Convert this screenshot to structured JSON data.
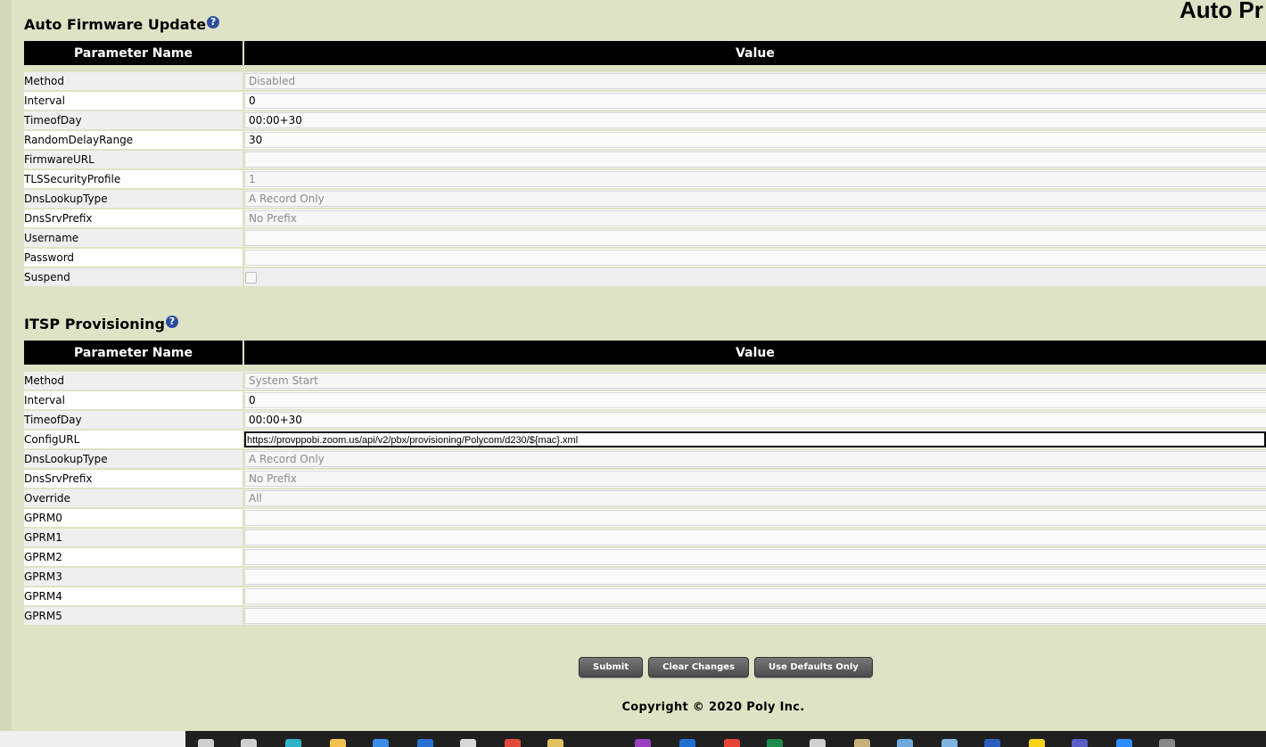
{
  "page_heading": "Auto Pr",
  "auto_firmware": {
    "title": "Auto Firmware Update",
    "help": "?",
    "header_name": "Parameter Name",
    "header_value": "Value",
    "rows": [
      {
        "name": "Method",
        "value": "Disabled",
        "kind": "select"
      },
      {
        "name": "Interval",
        "value": "0",
        "kind": "input"
      },
      {
        "name": "TimeofDay",
        "value": "00:00+30",
        "kind": "input"
      },
      {
        "name": "RandomDelayRange",
        "value": "30",
        "kind": "input"
      },
      {
        "name": "FirmwareURL",
        "value": "",
        "kind": "input"
      },
      {
        "name": "TLSSecurityProfile",
        "value": "1",
        "kind": "select"
      },
      {
        "name": "DnsLookupType",
        "value": "A Record Only",
        "kind": "select"
      },
      {
        "name": "DnsSrvPrefix",
        "value": "No Prefix",
        "kind": "select"
      },
      {
        "name": "Username",
        "value": "",
        "kind": "input"
      },
      {
        "name": "Password",
        "value": "",
        "kind": "input"
      },
      {
        "name": "Suspend",
        "value": "",
        "kind": "checkbox"
      }
    ]
  },
  "itsp": {
    "title": "ITSP Provisioning",
    "help": "?",
    "header_name": "Parameter Name",
    "header_value": "Value",
    "rows": [
      {
        "name": "Method",
        "value": "System Start",
        "kind": "select"
      },
      {
        "name": "Interval",
        "value": "0",
        "kind": "input"
      },
      {
        "name": "TimeofDay",
        "value": "00:00+30",
        "kind": "input"
      },
      {
        "name": "ConfigURL",
        "value": "https://provppobi.zoom.us/api/v2/pbx/provisioning/Polycom/d230/${mac}.xml",
        "kind": "active"
      },
      {
        "name": "DnsLookupType",
        "value": "A Record Only",
        "kind": "select"
      },
      {
        "name": "DnsSrvPrefix",
        "value": "No Prefix",
        "kind": "select"
      },
      {
        "name": "Override",
        "value": "All",
        "kind": "select"
      },
      {
        "name": "GPRM0",
        "value": "",
        "kind": "input"
      },
      {
        "name": "GPRM1",
        "value": "",
        "kind": "input"
      },
      {
        "name": "GPRM2",
        "value": "",
        "kind": "input"
      },
      {
        "name": "GPRM3",
        "value": "",
        "kind": "input"
      },
      {
        "name": "GPRM4",
        "value": "",
        "kind": "input"
      },
      {
        "name": "GPRM5",
        "value": "",
        "kind": "input"
      }
    ]
  },
  "buttons": {
    "submit": "Submit",
    "clear": "Clear Changes",
    "defaults": "Use Defaults Only"
  },
  "copyright": "Copyright © 2020 Poly Inc.",
  "taskbar_icons": [
    {
      "name": "search-icon",
      "color": "#cfcfcf"
    },
    {
      "name": "task-view-icon",
      "color": "#cfcfcf"
    },
    {
      "name": "edge-browser-icon",
      "color": "#2fb3c9"
    },
    {
      "name": "file-explorer-icon",
      "color": "#f2c14e"
    },
    {
      "name": "store-icon",
      "color": "#3a8ee6"
    },
    {
      "name": "mail-icon",
      "color": "#2a6fd1"
    },
    {
      "name": "chatgpt-icon",
      "color": "#d8d8d8"
    },
    {
      "name": "app-red-icon",
      "color": "#e04b3c"
    },
    {
      "name": "notes-icon",
      "color": "#e0c060"
    },
    {
      "name": "onenote-icon",
      "color": "#9b3ec0"
    },
    {
      "name": "outlook-icon",
      "color": "#1f6fd1"
    },
    {
      "name": "chrome-icon",
      "color": "#e54335"
    },
    {
      "name": "excel-icon",
      "color": "#1e8a4c"
    },
    {
      "name": "settings-icon",
      "color": "#d0d0d0"
    },
    {
      "name": "paint-icon",
      "color": "#c8b07a"
    },
    {
      "name": "calculator-icon",
      "color": "#6fa8dc"
    },
    {
      "name": "snip-icon",
      "color": "#7fb3e0"
    },
    {
      "name": "word-icon",
      "color": "#2b5fbf"
    },
    {
      "name": "sticky-notes-icon",
      "color": "#f7d31a"
    },
    {
      "name": "teams-icon",
      "color": "#5b5fc7"
    },
    {
      "name": "zoom-icon",
      "color": "#2d8cff"
    },
    {
      "name": "terminal-icon",
      "color": "#888888"
    }
  ]
}
